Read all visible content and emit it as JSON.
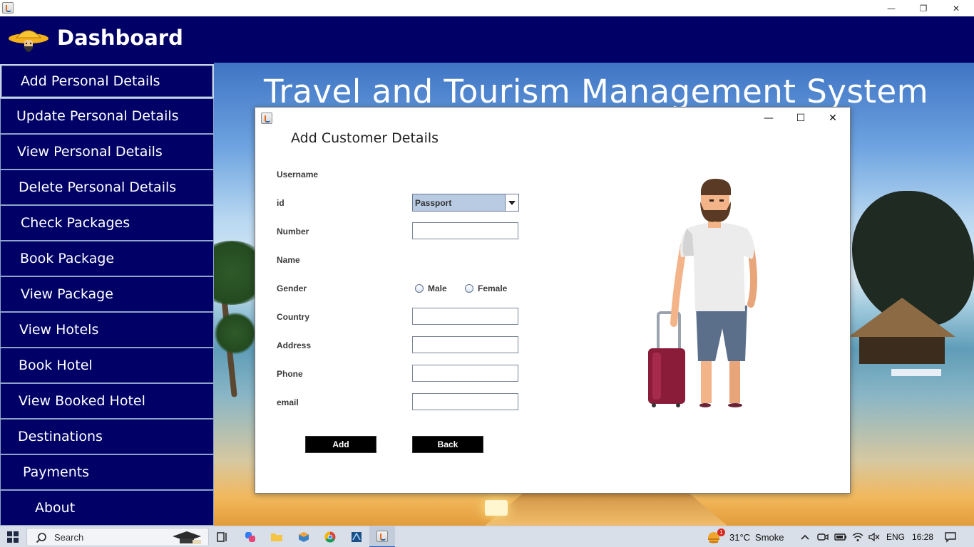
{
  "header": {
    "title": "Dashboard"
  },
  "sidebar": {
    "items": [
      {
        "label": "Add Personal Details"
      },
      {
        "label": "Update Personal Details"
      },
      {
        "label": "View Personal Details"
      },
      {
        "label": "Delete Personal Details"
      },
      {
        "label": "Check Packages"
      },
      {
        "label": "Book Package"
      },
      {
        "label": "View Package"
      },
      {
        "label": "View Hotels"
      },
      {
        "label": "Book Hotel"
      },
      {
        "label": "View Booked Hotel"
      },
      {
        "label": "Destinations"
      },
      {
        "label": "Payments"
      },
      {
        "label": "About"
      }
    ]
  },
  "background": {
    "title": "Travel and Tourism Management System"
  },
  "dialog": {
    "heading": "Add Customer Details",
    "labels": {
      "username": "Username",
      "id": "id",
      "number": "Number",
      "name": "Name",
      "gender": "Gender",
      "country": "Country",
      "address": "Address",
      "phone": "Phone",
      "email": "email"
    },
    "id_selected": "Passport",
    "fields": {
      "number": "",
      "country": "",
      "address": "",
      "phone": "",
      "email": ""
    },
    "gender_options": {
      "male": "Male",
      "female": "Female"
    },
    "buttons": {
      "add": "Add",
      "back": "Back"
    },
    "controls": {
      "minimize": "—",
      "maximize": "☐",
      "close": "✕"
    }
  },
  "window_controls": {
    "minimize": "—",
    "restore": "❐",
    "close": "✕"
  },
  "taskbar": {
    "search_placeholder": "Search",
    "weather_temp": "31°C",
    "weather_desc": "Smoke",
    "weather_badge": "1",
    "language": "ENG",
    "time": "16:28"
  },
  "colors": {
    "navy": "#000066",
    "button": "#000000",
    "combo": "#b8cbe3"
  }
}
